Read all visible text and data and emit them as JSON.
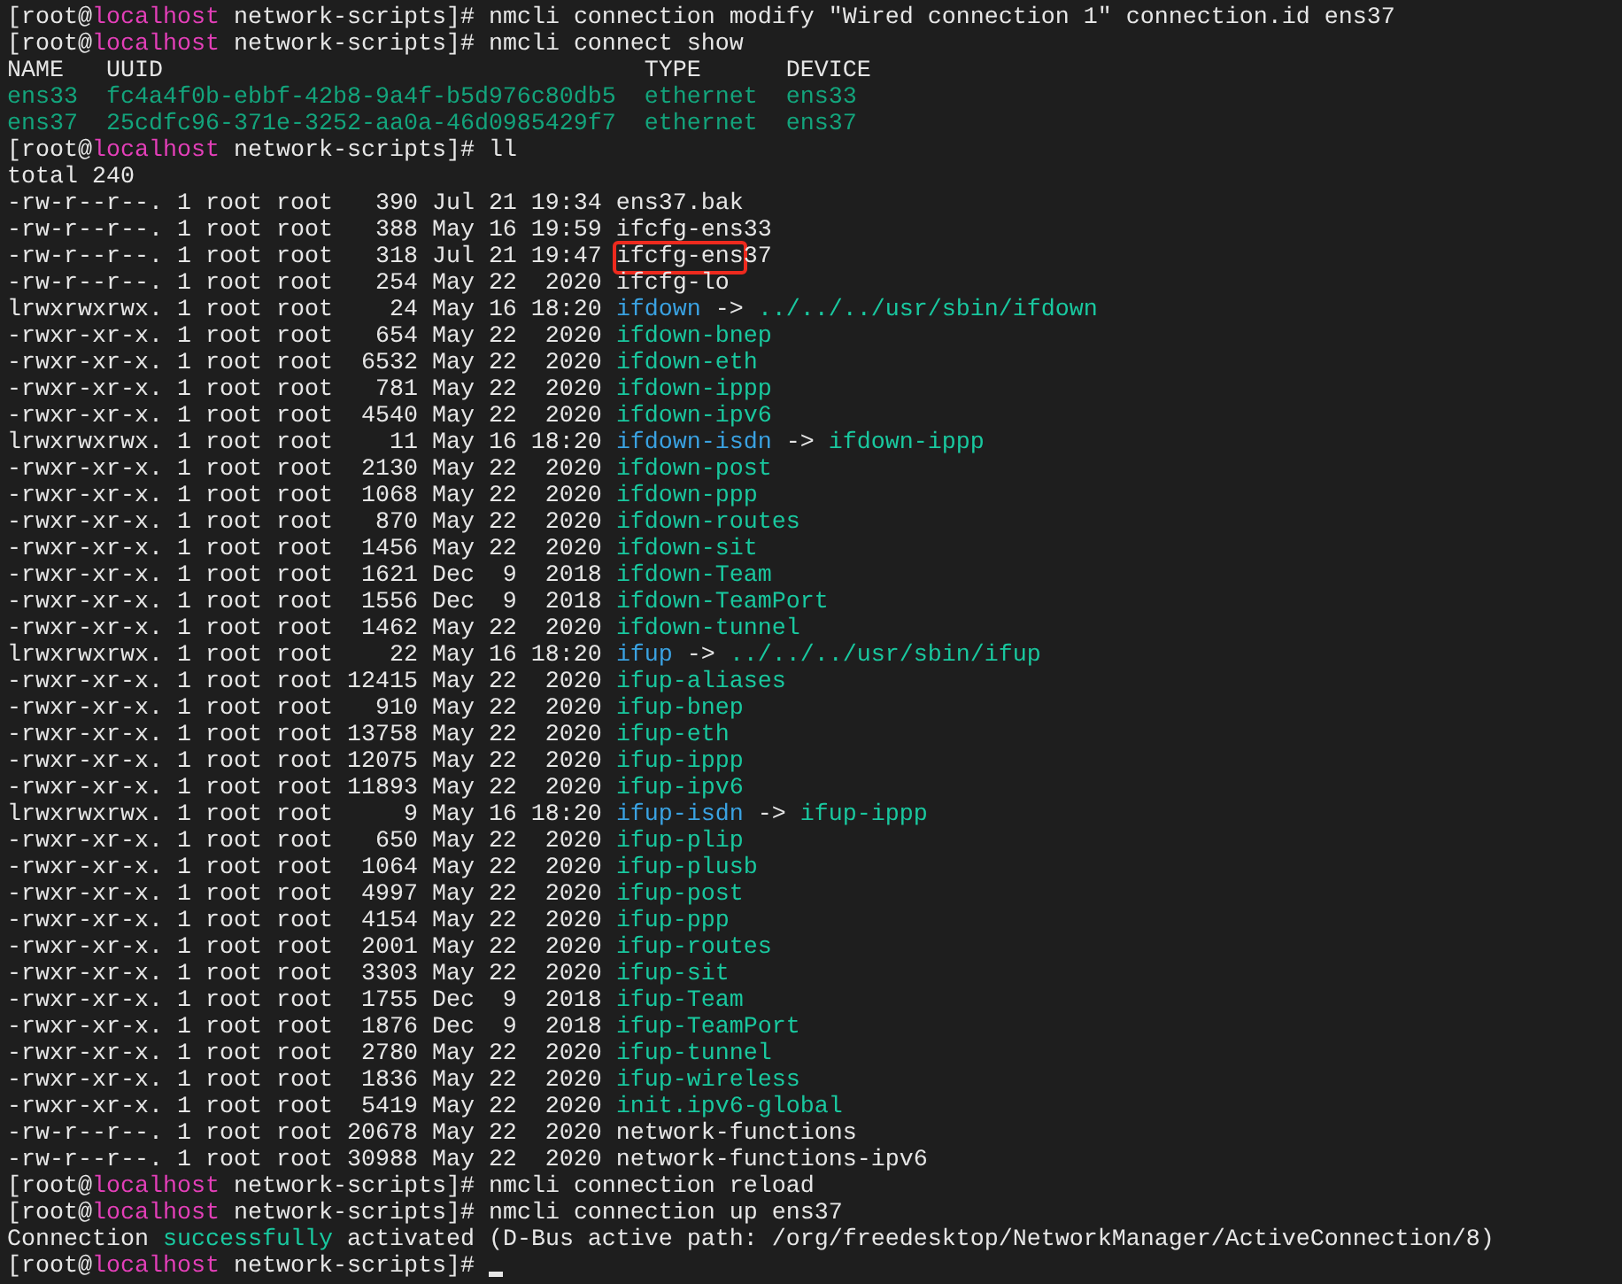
{
  "terminal": {
    "cursor_visible": true,
    "lines": [
      {
        "segments": [
          {
            "text": "[root@",
            "kind": "plain"
          },
          {
            "text": "localhost",
            "kind": "host"
          },
          {
            "text": " network-scripts]# nmcli connection modify \"Wired connection 1\" connection.id ens37",
            "kind": "plain"
          }
        ]
      },
      {
        "segments": [
          {
            "text": "[root@",
            "kind": "plain"
          },
          {
            "text": "localhost",
            "kind": "host"
          },
          {
            "text": " network-scripts]# nmcli connect show",
            "kind": "plain"
          }
        ]
      },
      {
        "segments": [
          {
            "text": "NAME   UUID                                  TYPE      DEVICE",
            "kind": "plain"
          }
        ]
      },
      {
        "segments": [
          {
            "text": "ens33  fc4a4f0b-ebbf-42b8-9a4f-b5d976c80db5  ethernet  ens33",
            "kind": "nm"
          }
        ]
      },
      {
        "segments": [
          {
            "text": "ens37  25cdfc96-371e-3252-aa0a-46d0985429f7  ethernet  ens37",
            "kind": "nm"
          }
        ]
      },
      {
        "segments": [
          {
            "text": "[root@",
            "kind": "plain"
          },
          {
            "text": "localhost",
            "kind": "host"
          },
          {
            "text": " network-scripts]# ll",
            "kind": "plain"
          }
        ]
      },
      {
        "segments": [
          {
            "text": "total 240",
            "kind": "plain"
          }
        ]
      },
      {
        "segments": [
          {
            "text": "-rw-r--r--. 1 root root   390 Jul 21 19:34 ens37.bak",
            "kind": "plain"
          }
        ]
      },
      {
        "segments": [
          {
            "text": "-rw-r--r--. 1 root root   388 May 16 19:59 ifcfg-ens33",
            "kind": "plain"
          }
        ]
      },
      {
        "segments": [
          {
            "text": "-rw-r--r--. 1 root root   318 Jul 21 19:47 ",
            "kind": "plain"
          },
          {
            "text": "ifcfg-ens",
            "kind": "plain",
            "boxed": true
          },
          {
            "text": "37",
            "kind": "plain"
          }
        ]
      },
      {
        "segments": [
          {
            "text": "-rw-r--r--. 1 root root   254 May 22  2020 ifcfg-lo",
            "kind": "plain"
          }
        ]
      },
      {
        "segments": [
          {
            "text": "lrwxrwxrwx. 1 root root    24 May 16 18:20 ",
            "kind": "plain"
          },
          {
            "text": "ifdown",
            "kind": "link"
          },
          {
            "text": " -> ",
            "kind": "plain"
          },
          {
            "text": "../../../usr/sbin/ifdown",
            "kind": "exec"
          }
        ]
      },
      {
        "segments": [
          {
            "text": "-rwxr-xr-x. 1 root root   654 May 22  2020 ",
            "kind": "plain"
          },
          {
            "text": "ifdown-bnep",
            "kind": "exec"
          }
        ]
      },
      {
        "segments": [
          {
            "text": "-rwxr-xr-x. 1 root root  6532 May 22  2020 ",
            "kind": "plain"
          },
          {
            "text": "ifdown-eth",
            "kind": "exec"
          }
        ]
      },
      {
        "segments": [
          {
            "text": "-rwxr-xr-x. 1 root root   781 May 22  2020 ",
            "kind": "plain"
          },
          {
            "text": "ifdown-ippp",
            "kind": "exec"
          }
        ]
      },
      {
        "segments": [
          {
            "text": "-rwxr-xr-x. 1 root root  4540 May 22  2020 ",
            "kind": "plain"
          },
          {
            "text": "ifdown-ipv6",
            "kind": "exec"
          }
        ]
      },
      {
        "segments": [
          {
            "text": "lrwxrwxrwx. 1 root root    11 May 16 18:20 ",
            "kind": "plain"
          },
          {
            "text": "ifdown-isdn",
            "kind": "link"
          },
          {
            "text": " -> ",
            "kind": "plain"
          },
          {
            "text": "ifdown-ippp",
            "kind": "exec"
          }
        ]
      },
      {
        "segments": [
          {
            "text": "-rwxr-xr-x. 1 root root  2130 May 22  2020 ",
            "kind": "plain"
          },
          {
            "text": "ifdown-post",
            "kind": "exec"
          }
        ]
      },
      {
        "segments": [
          {
            "text": "-rwxr-xr-x. 1 root root  1068 May 22  2020 ",
            "kind": "plain"
          },
          {
            "text": "ifdown-ppp",
            "kind": "exec"
          }
        ]
      },
      {
        "segments": [
          {
            "text": "-rwxr-xr-x. 1 root root   870 May 22  2020 ",
            "kind": "plain"
          },
          {
            "text": "ifdown-routes",
            "kind": "exec"
          }
        ]
      },
      {
        "segments": [
          {
            "text": "-rwxr-xr-x. 1 root root  1456 May 22  2020 ",
            "kind": "plain"
          },
          {
            "text": "ifdown-sit",
            "kind": "exec"
          }
        ]
      },
      {
        "segments": [
          {
            "text": "-rwxr-xr-x. 1 root root  1621 Dec  9  2018 ",
            "kind": "plain"
          },
          {
            "text": "ifdown-Team",
            "kind": "exec"
          }
        ]
      },
      {
        "segments": [
          {
            "text": "-rwxr-xr-x. 1 root root  1556 Dec  9  2018 ",
            "kind": "plain"
          },
          {
            "text": "ifdown-TeamPort",
            "kind": "exec"
          }
        ]
      },
      {
        "segments": [
          {
            "text": "-rwxr-xr-x. 1 root root  1462 May 22  2020 ",
            "kind": "plain"
          },
          {
            "text": "ifdown-tunnel",
            "kind": "exec"
          }
        ]
      },
      {
        "segments": [
          {
            "text": "lrwxrwxrwx. 1 root root    22 May 16 18:20 ",
            "kind": "plain"
          },
          {
            "text": "ifup",
            "kind": "link"
          },
          {
            "text": " -> ",
            "kind": "plain"
          },
          {
            "text": "../../../usr/sbin/ifup",
            "kind": "exec"
          }
        ]
      },
      {
        "segments": [
          {
            "text": "-rwxr-xr-x. 1 root root 12415 May 22  2020 ",
            "kind": "plain"
          },
          {
            "text": "ifup-aliases",
            "kind": "exec"
          }
        ]
      },
      {
        "segments": [
          {
            "text": "-rwxr-xr-x. 1 root root   910 May 22  2020 ",
            "kind": "plain"
          },
          {
            "text": "ifup-bnep",
            "kind": "exec"
          }
        ]
      },
      {
        "segments": [
          {
            "text": "-rwxr-xr-x. 1 root root 13758 May 22  2020 ",
            "kind": "plain"
          },
          {
            "text": "ifup-eth",
            "kind": "exec"
          }
        ]
      },
      {
        "segments": [
          {
            "text": "-rwxr-xr-x. 1 root root 12075 May 22  2020 ",
            "kind": "plain"
          },
          {
            "text": "ifup-ippp",
            "kind": "exec"
          }
        ]
      },
      {
        "segments": [
          {
            "text": "-rwxr-xr-x. 1 root root 11893 May 22  2020 ",
            "kind": "plain"
          },
          {
            "text": "ifup-ipv6",
            "kind": "exec"
          }
        ]
      },
      {
        "segments": [
          {
            "text": "lrwxrwxrwx. 1 root root     9 May 16 18:20 ",
            "kind": "plain"
          },
          {
            "text": "ifup-isdn",
            "kind": "link"
          },
          {
            "text": " -> ",
            "kind": "plain"
          },
          {
            "text": "ifup-ippp",
            "kind": "exec"
          }
        ]
      },
      {
        "segments": [
          {
            "text": "-rwxr-xr-x. 1 root root   650 May 22  2020 ",
            "kind": "plain"
          },
          {
            "text": "ifup-plip",
            "kind": "exec"
          }
        ]
      },
      {
        "segments": [
          {
            "text": "-rwxr-xr-x. 1 root root  1064 May 22  2020 ",
            "kind": "plain"
          },
          {
            "text": "ifup-plusb",
            "kind": "exec"
          }
        ]
      },
      {
        "segments": [
          {
            "text": "-rwxr-xr-x. 1 root root  4997 May 22  2020 ",
            "kind": "plain"
          },
          {
            "text": "ifup-post",
            "kind": "exec"
          }
        ]
      },
      {
        "segments": [
          {
            "text": "-rwxr-xr-x. 1 root root  4154 May 22  2020 ",
            "kind": "plain"
          },
          {
            "text": "ifup-ppp",
            "kind": "exec"
          }
        ]
      },
      {
        "segments": [
          {
            "text": "-rwxr-xr-x. 1 root root  2001 May 22  2020 ",
            "kind": "plain"
          },
          {
            "text": "ifup-routes",
            "kind": "exec"
          }
        ]
      },
      {
        "segments": [
          {
            "text": "-rwxr-xr-x. 1 root root  3303 May 22  2020 ",
            "kind": "plain"
          },
          {
            "text": "ifup-sit",
            "kind": "exec"
          }
        ]
      },
      {
        "segments": [
          {
            "text": "-rwxr-xr-x. 1 root root  1755 Dec  9  2018 ",
            "kind": "plain"
          },
          {
            "text": "ifup-Team",
            "kind": "exec"
          }
        ]
      },
      {
        "segments": [
          {
            "text": "-rwxr-xr-x. 1 root root  1876 Dec  9  2018 ",
            "kind": "plain"
          },
          {
            "text": "ifup-TeamPort",
            "kind": "exec"
          }
        ]
      },
      {
        "segments": [
          {
            "text": "-rwxr-xr-x. 1 root root  2780 May 22  2020 ",
            "kind": "plain"
          },
          {
            "text": "ifup-tunnel",
            "kind": "exec"
          }
        ]
      },
      {
        "segments": [
          {
            "text": "-rwxr-xr-x. 1 root root  1836 May 22  2020 ",
            "kind": "plain"
          },
          {
            "text": "ifup-wireless",
            "kind": "exec"
          }
        ]
      },
      {
        "segments": [
          {
            "text": "-rwxr-xr-x. 1 root root  5419 May 22  2020 ",
            "kind": "plain"
          },
          {
            "text": "init.ipv6-global",
            "kind": "exec"
          }
        ]
      },
      {
        "segments": [
          {
            "text": "-rw-r--r--. 1 root root 20678 May 22  2020 network-functions",
            "kind": "plain"
          }
        ]
      },
      {
        "segments": [
          {
            "text": "-rw-r--r--. 1 root root 30988 May 22  2020 network-functions-ipv6",
            "kind": "plain"
          }
        ]
      },
      {
        "segments": [
          {
            "text": "[root@",
            "kind": "plain"
          },
          {
            "text": "localhost",
            "kind": "host"
          },
          {
            "text": " network-scripts]# nmcli connection reload",
            "kind": "plain"
          }
        ]
      },
      {
        "segments": [
          {
            "text": "[root@",
            "kind": "plain"
          },
          {
            "text": "localhost",
            "kind": "host"
          },
          {
            "text": " network-scripts]# nmcli connection up ens37",
            "kind": "plain"
          }
        ]
      },
      {
        "segments": [
          {
            "text": "Connection ",
            "kind": "plain"
          },
          {
            "text": "successfully",
            "kind": "ok"
          },
          {
            "text": " activated (D-Bus active path: /org/freedesktop/NetworkManager/ActiveConnection/8)",
            "kind": "plain"
          }
        ]
      },
      {
        "segments": [
          {
            "text": "[root@",
            "kind": "plain"
          },
          {
            "text": "localhost",
            "kind": "host"
          },
          {
            "text": " network-scripts]# ",
            "kind": "plain"
          }
        ]
      }
    ]
  }
}
